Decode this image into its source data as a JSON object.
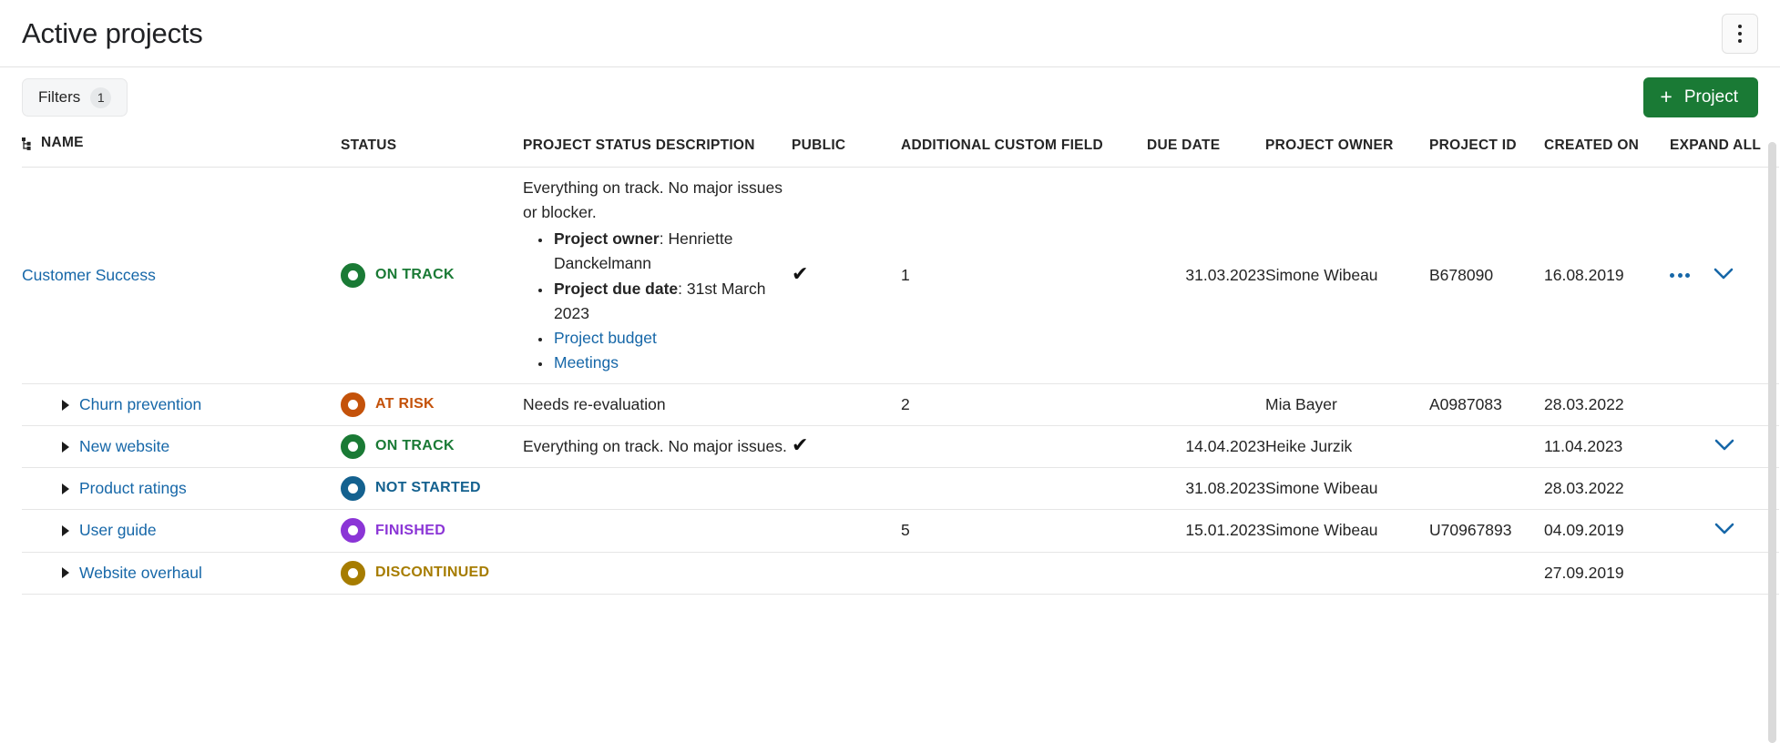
{
  "header": {
    "title": "Active projects",
    "kebab_label": "More options"
  },
  "toolbar": {
    "filters_label": "Filters",
    "filters_count": "1",
    "project_button_label": "Project",
    "project_button_plus": "+",
    "project_button_color": "#1a7a35"
  },
  "columns": {
    "name": "NAME",
    "status": "STATUS",
    "description": "PROJECT STATUS DESCRIPTION",
    "public": "PUBLIC",
    "custom_field": "ADDITIONAL CUSTOM FIELD",
    "due_date": "DUE DATE",
    "owner": "PROJECT OWNER",
    "project_id": "PROJECT ID",
    "created_on": "CREATED ON",
    "expand_all": "EXPAND ALL"
  },
  "status_colors": {
    "ON TRACK": "#1a7a35",
    "AT RISK": "#c4520a",
    "NOT STARTED": "#14618f",
    "FINISHED": "#8b35d6",
    "DISCONTINUED": "#a67c00"
  },
  "rows": [
    {
      "name": "Customer Success",
      "indent": false,
      "caret": false,
      "status": "ON TRACK",
      "desc_intro": "Everything on track. No major issues or blocker.",
      "desc_items": [
        {
          "label": "Project owner",
          "value": ": Henriette Danckelmann",
          "link": false
        },
        {
          "label": "Project due date",
          "value": ": 31st March 2023",
          "link": false
        },
        {
          "label": "Project budget",
          "value": "",
          "link": true
        },
        {
          "label": "Meetings",
          "value": "",
          "link": true
        }
      ],
      "public": "✔",
      "custom_field": "1",
      "due_date": "31.03.2023",
      "owner": "Simone Wibeau",
      "project_id": "B678090",
      "created_on": "16.08.2019",
      "has_ellipsis": true,
      "has_chevron": true
    },
    {
      "name": "Churn prevention",
      "indent": true,
      "caret": true,
      "status": "AT RISK",
      "desc_intro": "Needs re-evaluation",
      "desc_items": [],
      "public": "",
      "custom_field": "2",
      "due_date": "",
      "owner": "Mia Bayer",
      "project_id": "A0987083",
      "created_on": "28.03.2022",
      "has_ellipsis": false,
      "has_chevron": false
    },
    {
      "name": "New website",
      "indent": true,
      "caret": true,
      "status": "ON TRACK",
      "desc_intro": "Everything on track. No major issues.",
      "desc_items": [],
      "public": "✔",
      "custom_field": "",
      "due_date": "14.04.2023",
      "owner": "Heike Jurzik",
      "project_id": "",
      "created_on": "11.04.2023",
      "has_ellipsis": false,
      "has_chevron": true
    },
    {
      "name": "Product ratings",
      "indent": true,
      "caret": true,
      "status": "NOT STARTED",
      "desc_intro": "",
      "desc_items": [],
      "public": "",
      "custom_field": "",
      "due_date": "31.08.2023",
      "owner": "Simone Wibeau",
      "project_id": "",
      "created_on": "28.03.2022",
      "has_ellipsis": false,
      "has_chevron": false
    },
    {
      "name": "User guide",
      "indent": true,
      "caret": true,
      "status": "FINISHED",
      "desc_intro": "",
      "desc_items": [],
      "public": "",
      "custom_field": "5",
      "due_date": "15.01.2023",
      "owner": "Simone Wibeau",
      "project_id": "U70967893",
      "created_on": "04.09.2019",
      "has_ellipsis": false,
      "has_chevron": true
    },
    {
      "name": "Website overhaul",
      "indent": true,
      "caret": true,
      "status": "DISCONTINUED",
      "desc_intro": "",
      "desc_items": [],
      "public": "",
      "custom_field": "",
      "due_date": "",
      "owner": "",
      "project_id": "",
      "created_on": "27.09.2019",
      "has_ellipsis": false,
      "has_chevron": false
    }
  ]
}
